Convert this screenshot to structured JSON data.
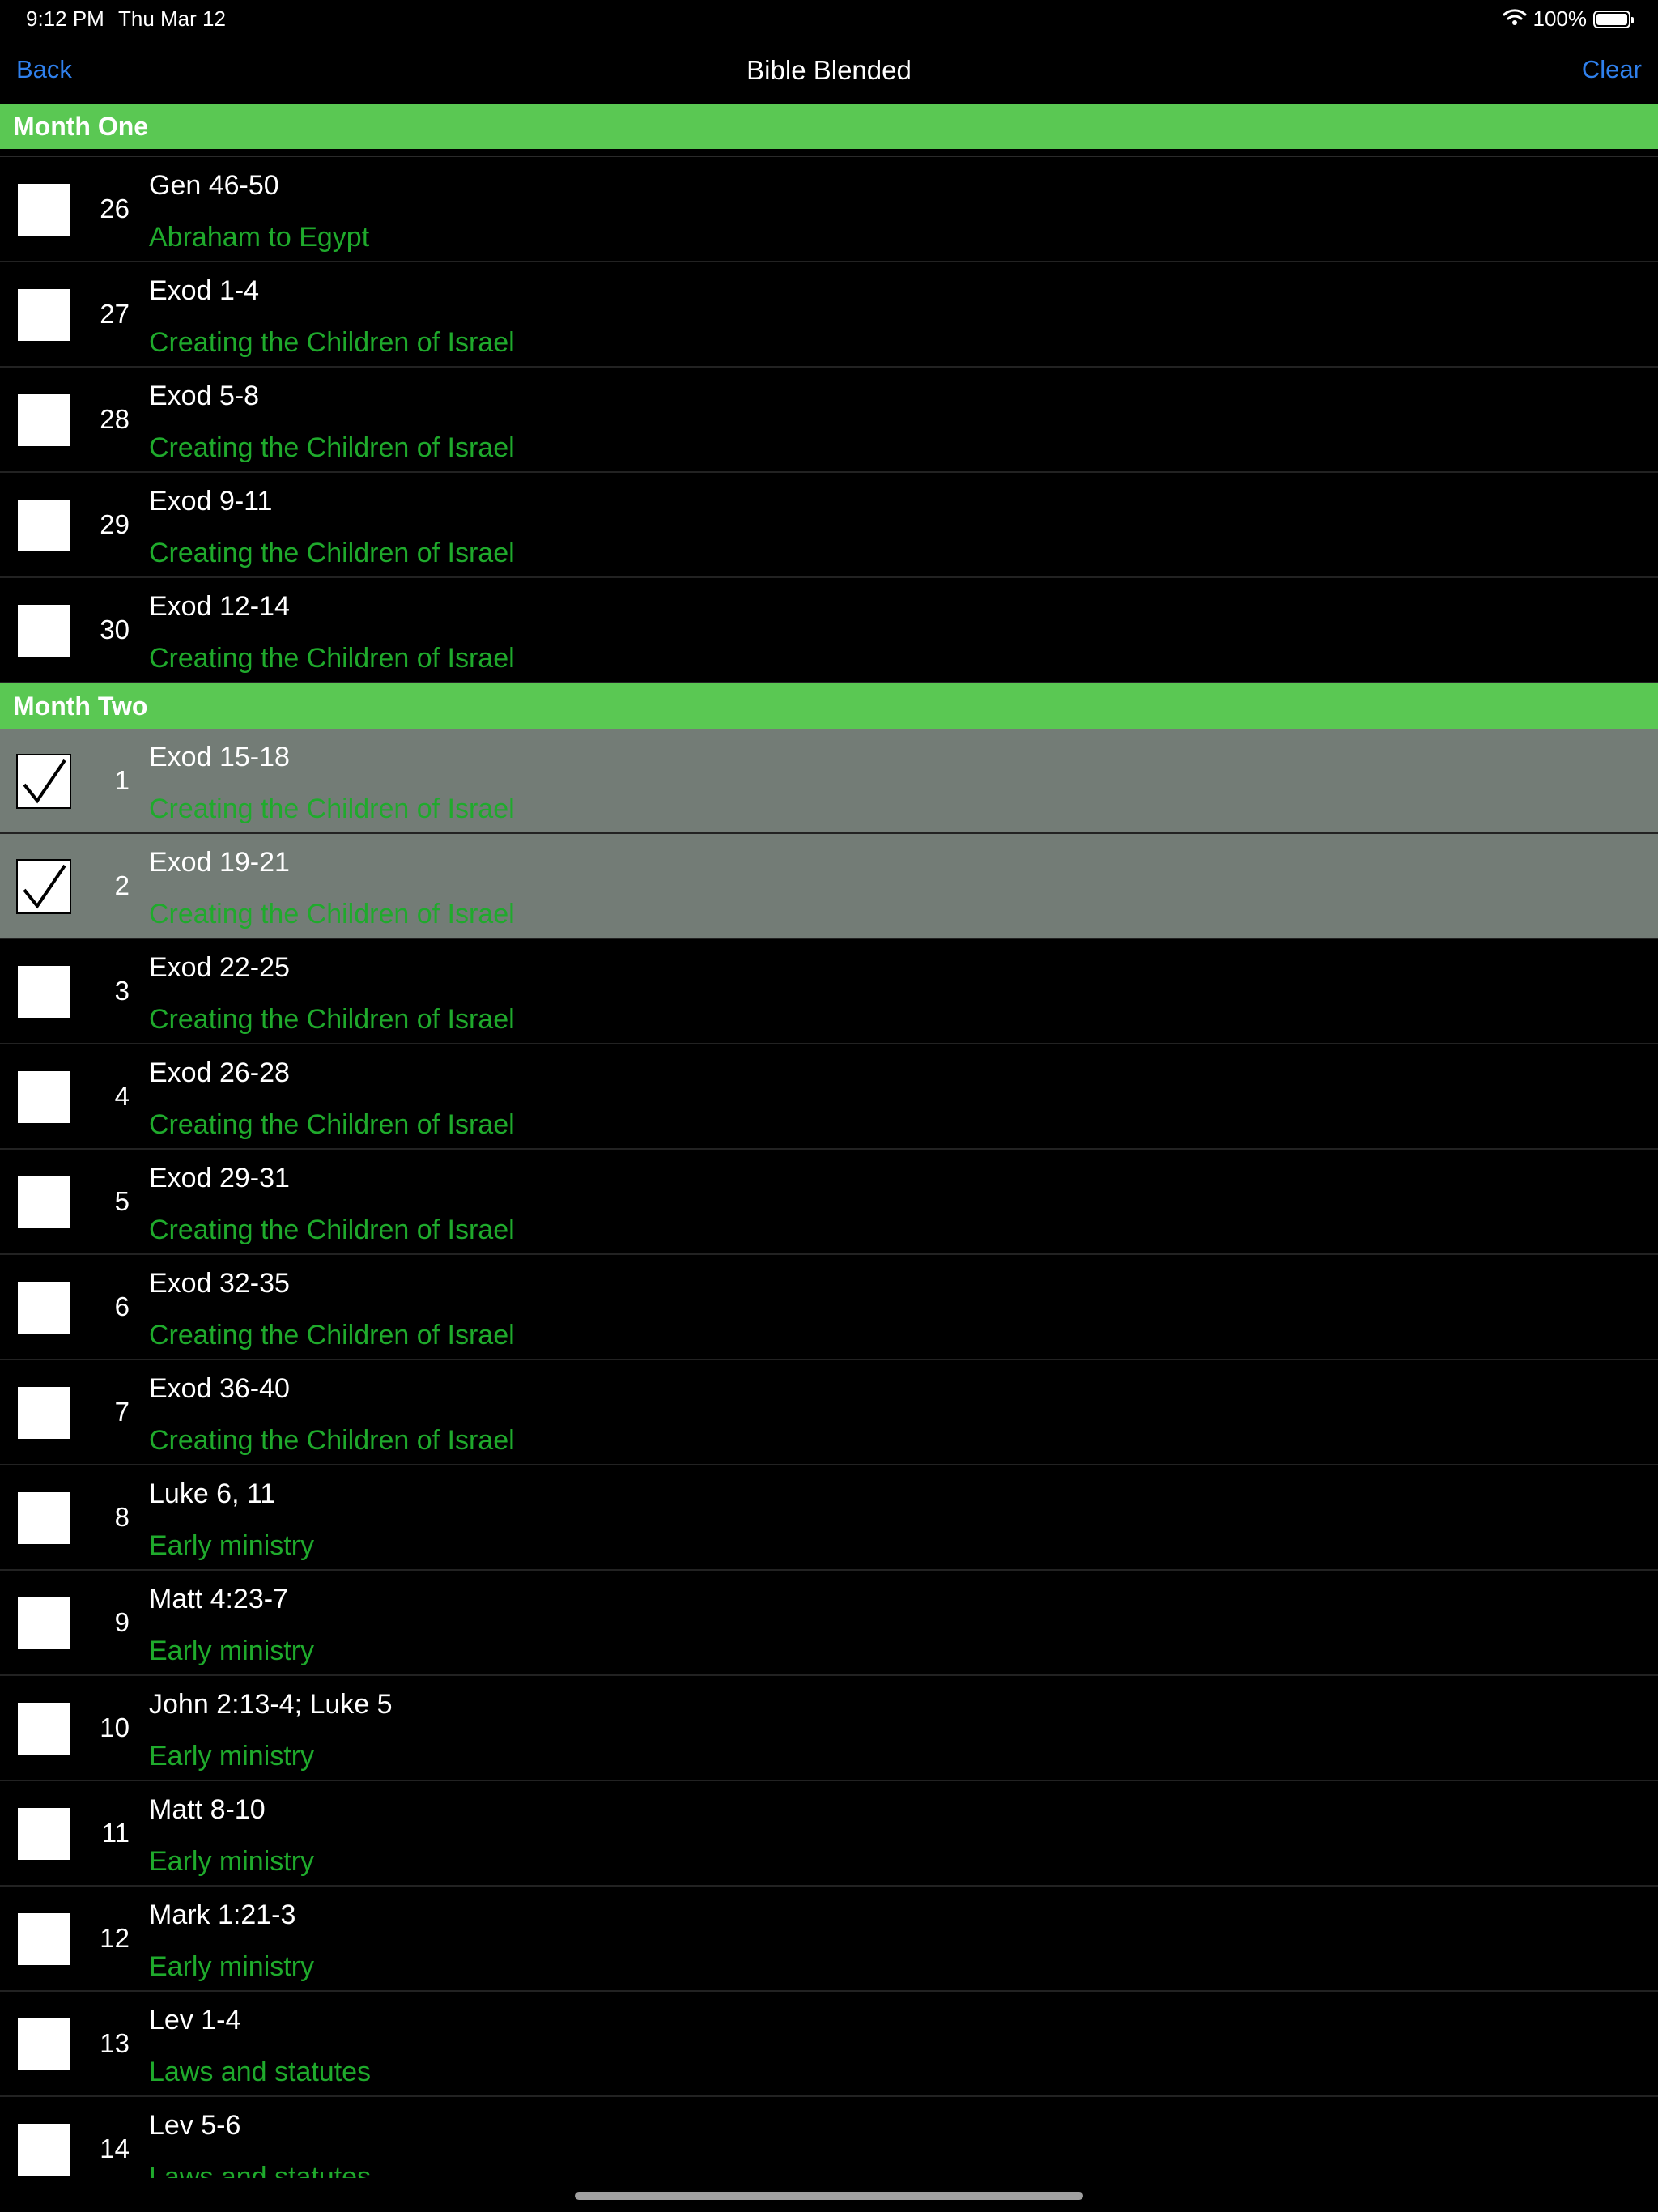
{
  "status_bar": {
    "time": "9:12 PM",
    "date": "Thu Mar 12",
    "battery": "100%",
    "battery_level": 1.0
  },
  "nav": {
    "back": "Back",
    "title": "Bible Blended",
    "clear": "Clear"
  },
  "sections": [
    {
      "title": "Month One",
      "rows": [
        {
          "day": "26",
          "ref": "Gen 46-50",
          "theme": "Abraham to Egypt",
          "checked": false
        },
        {
          "day": "27",
          "ref": "Exod 1-4",
          "theme": "Creating the Children of Israel",
          "checked": false
        },
        {
          "day": "28",
          "ref": "Exod 5-8",
          "theme": "Creating the Children of Israel",
          "checked": false
        },
        {
          "day": "29",
          "ref": "Exod 9-11",
          "theme": "Creating the Children of Israel",
          "checked": false
        },
        {
          "day": "30",
          "ref": "Exod 12-14",
          "theme": "Creating the Children of Israel",
          "checked": false
        }
      ]
    },
    {
      "title": "Month Two",
      "rows": [
        {
          "day": "1",
          "ref": "Exod 15-18",
          "theme": "Creating the Children of Israel",
          "checked": true
        },
        {
          "day": "2",
          "ref": "Exod 19-21",
          "theme": "Creating the Children of Israel",
          "checked": true
        },
        {
          "day": "3",
          "ref": "Exod 22-25",
          "theme": "Creating the Children of Israel",
          "checked": false
        },
        {
          "day": "4",
          "ref": "Exod 26-28",
          "theme": "Creating the Children of Israel",
          "checked": false
        },
        {
          "day": "5",
          "ref": "Exod 29-31",
          "theme": "Creating the Children of Israel",
          "checked": false
        },
        {
          "day": "6",
          "ref": "Exod 32-35",
          "theme": "Creating the Children of Israel",
          "checked": false
        },
        {
          "day": "7",
          "ref": "Exod 36-40",
          "theme": "Creating the Children of Israel",
          "checked": false
        },
        {
          "day": "8",
          "ref": "Luke 6, 11",
          "theme": "Early ministry",
          "checked": false
        },
        {
          "day": "9",
          "ref": "Matt 4:23-7",
          "theme": "Early ministry",
          "checked": false
        },
        {
          "day": "10",
          "ref": "John 2:13-4; Luke 5",
          "theme": "Early ministry",
          "checked": false
        },
        {
          "day": "11",
          "ref": "Matt 8-10",
          "theme": "Early ministry",
          "checked": false
        },
        {
          "day": "12",
          "ref": "Mark 1:21-3",
          "theme": "Early ministry",
          "checked": false
        },
        {
          "day": "13",
          "ref": "Lev 1-4",
          "theme": "Laws and statutes",
          "checked": false
        },
        {
          "day": "14",
          "ref": "Lev 5-6",
          "theme": "Laws and statutes",
          "checked": false
        }
      ]
    }
  ],
  "colors": {
    "section_header": "#5ac853",
    "theme_text": "#1faa2c",
    "nav_button": "#2f80ed",
    "checked_row": "#737c76"
  }
}
